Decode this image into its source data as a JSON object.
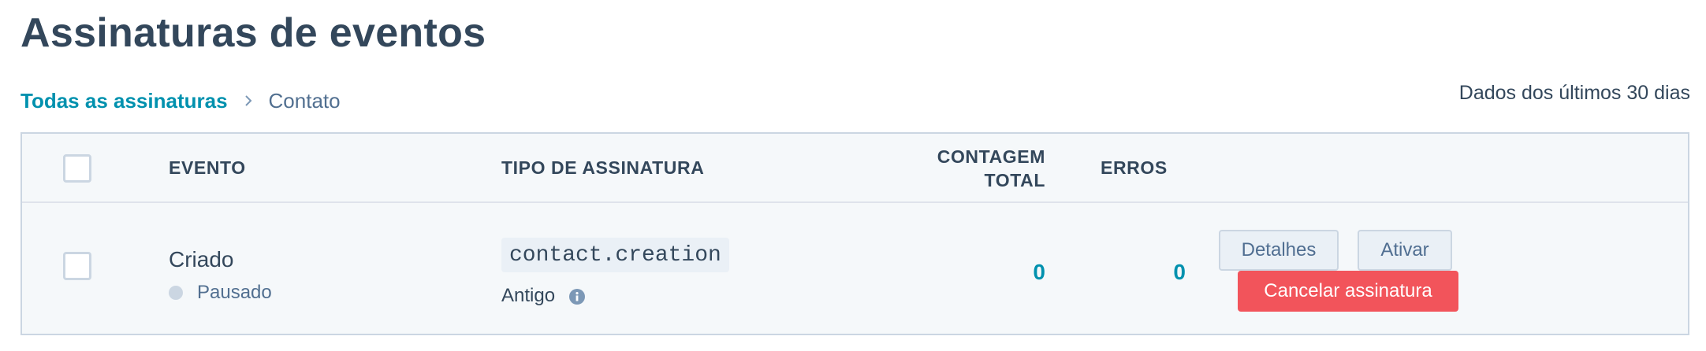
{
  "page": {
    "title": "Assinaturas de eventos"
  },
  "breadcrumb": {
    "parent_label": "Todas as assinaturas",
    "current_label": "Contato",
    "separator_icon": "chevron-right-icon"
  },
  "range_note": "Dados dos últimos 30 dias",
  "table": {
    "columns": {
      "event": "EVENTO",
      "subscription_type": "TIPO DE ASSINATURA",
      "total_count": "CONTAGEM TOTAL",
      "errors": "ERROS"
    },
    "rows": [
      {
        "event_name": "Criado",
        "status": "Pausado",
        "subscription_code": "contact.creation",
        "subscription_label": "Antigo",
        "info_icon": "info-icon",
        "total_count": "0",
        "errors": "0",
        "actions": {
          "details": "Detalhes",
          "activate": "Ativar",
          "cancel": "Cancelar assinatura"
        }
      }
    ]
  },
  "colors": {
    "text": "#33475b",
    "link": "#0091ae",
    "danger": "#f2545b",
    "table_bg": "#f5f8fa",
    "border": "#cbd6e2"
  }
}
